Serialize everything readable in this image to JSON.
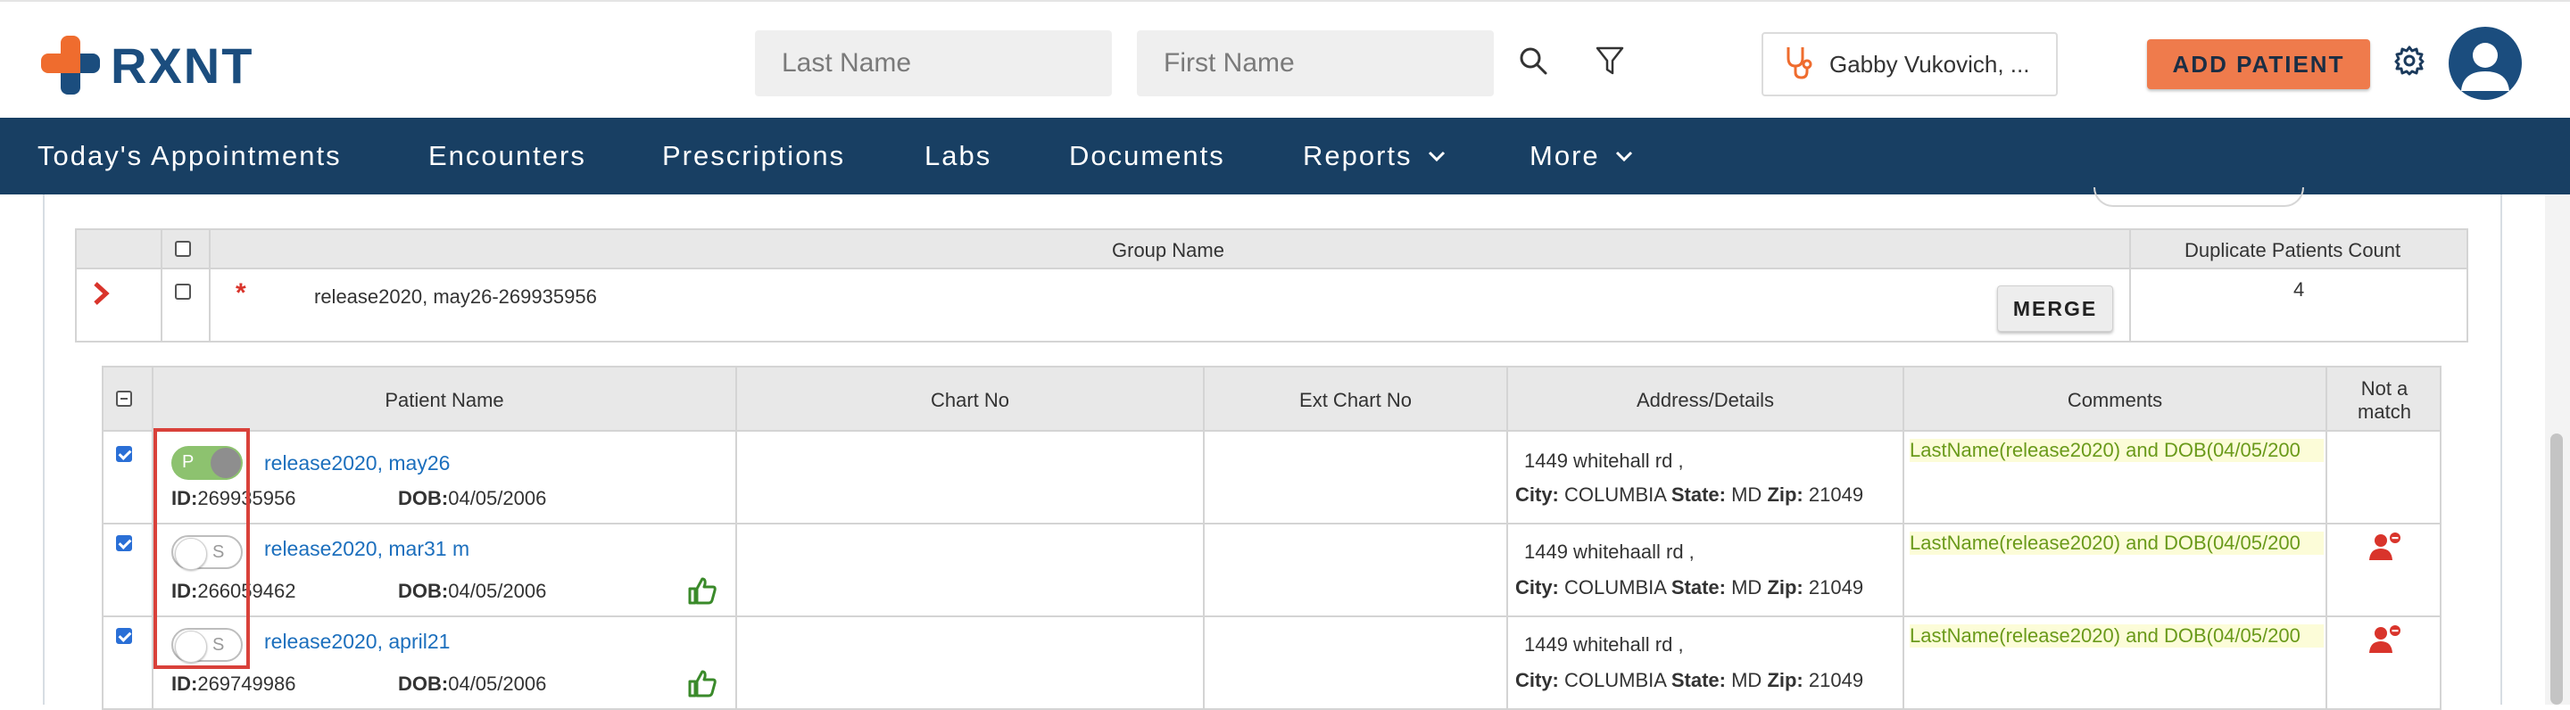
{
  "header": {
    "brand": "RXNT",
    "last_name_placeholder": "Last Name",
    "first_name_placeholder": "First Name",
    "provider_name": "Gabby Vukovich, ...",
    "add_patient_label": "ADD PATIENT"
  },
  "nav": {
    "items": [
      {
        "label": "Today's Appointments"
      },
      {
        "label": "Encounters"
      },
      {
        "label": "Prescriptions"
      },
      {
        "label": "Labs"
      },
      {
        "label": "Documents"
      },
      {
        "label": "Reports"
      },
      {
        "label": "More"
      }
    ]
  },
  "group_table": {
    "headers": {
      "group_name": "Group Name",
      "duplicate_count": "Duplicate Patients Count"
    },
    "row": {
      "group_name": "release2020, may26-269935956",
      "merge_label": "MERGE",
      "duplicate_count": "4",
      "marker": "*"
    }
  },
  "patient_table": {
    "headers": {
      "patient_name": "Patient Name",
      "chart_no": "Chart No",
      "ext_chart_no": "Ext Chart No",
      "address": "Address/Details",
      "comments": "Comments",
      "not_match_line1": "Not a",
      "not_match_line2": "match"
    },
    "labels": {
      "id": "ID:",
      "dob": "DOB:",
      "city": "City:",
      "state": "State:",
      "zip": "Zip:"
    },
    "rows": [
      {
        "checked": true,
        "toggle_label": "P",
        "toggle_on": true,
        "name": "release2020, may26",
        "id": "269935956",
        "dob": "04/05/2006",
        "address": "1449 whitehall rd ,",
        "city": "COLUMBIA",
        "state": "MD",
        "zip": "21049",
        "comment": "LastName(release2020) and DOB(04/05/200",
        "thumbs_up": false,
        "not_match_icon": false
      },
      {
        "checked": true,
        "toggle_label": "S",
        "toggle_on": false,
        "name": "release2020, mar31 m",
        "id": "266059462",
        "dob": "04/05/2006",
        "address": "1449 whitehaall rd ,",
        "city": "COLUMBIA",
        "state": "MD",
        "zip": "21049",
        "comment": "LastName(release2020) and DOB(04/05/200",
        "thumbs_up": true,
        "not_match_icon": true
      },
      {
        "checked": true,
        "toggle_label": "S",
        "toggle_on": false,
        "name": "release2020, april21",
        "id": "269749986",
        "dob": "04/05/2006",
        "address": "1449 whitehall rd ,",
        "city": "COLUMBIA",
        "state": "MD",
        "zip": "21049",
        "comment": "LastName(release2020) and DOB(04/05/200",
        "thumbs_up": true,
        "not_match_icon": true
      }
    ]
  },
  "colors": {
    "brand_blue": "#1b4d7e",
    "brand_orange": "#ef6c2e",
    "nav_bg": "#183f63",
    "add_patient_bg": "#ef7b4c",
    "highlight_red": "#d9413a",
    "toggle_on": "#8dc26f",
    "thumbs_green": "#3a8a2a",
    "not_match_red": "#d9342b"
  }
}
